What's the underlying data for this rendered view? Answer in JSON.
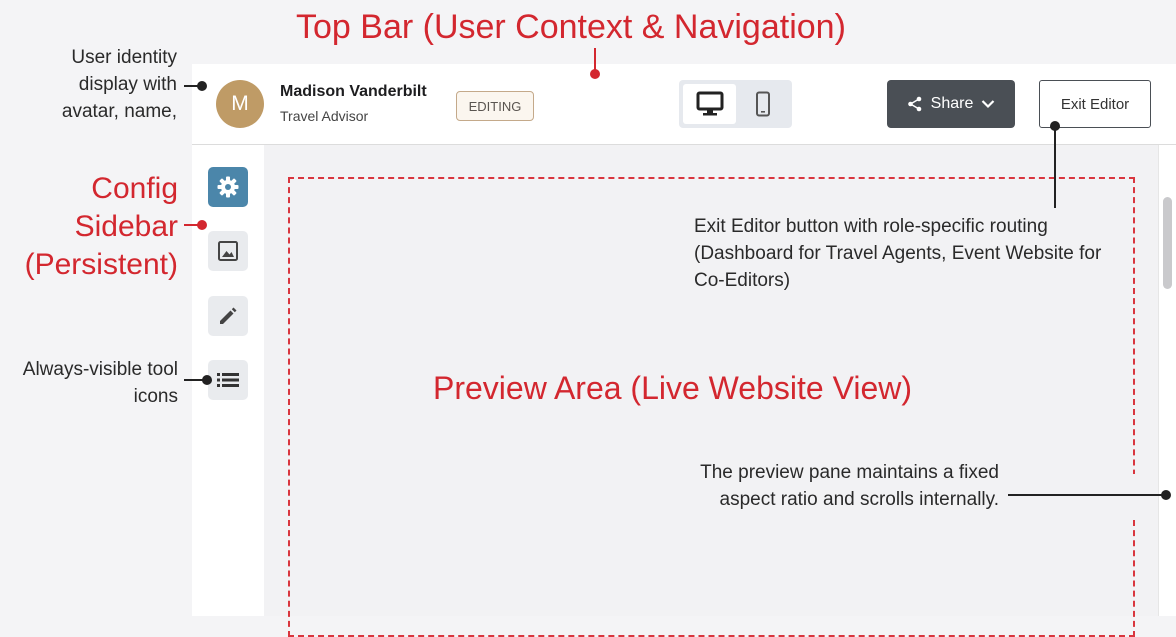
{
  "annotations": {
    "top_bar_title": "Top Bar (User Context & Navigation)",
    "config_sidebar_title": [
      "Config",
      "Sidebar",
      "(Persistent)"
    ],
    "preview_area_title": "Preview Area (Live Website View)",
    "user_identity_note": "User identity display with avatar, name,",
    "tools_note": "Always-visible tool icons",
    "exit_editor_note": "Exit Editor button with role-specific routing (Dashboard for Travel Agents, Event Website for Co-Editors)",
    "preview_note": "The preview pane maintains a fixed aspect ratio and scrolls internally."
  },
  "user": {
    "avatar_initial": "M",
    "name": "Madison Vanderbilt",
    "role": "Travel Advisor",
    "avatar_color": "#bf9b66"
  },
  "status_badge": "EDITING",
  "device_toggle": {
    "options": [
      "desktop-icon",
      "mobile-icon"
    ],
    "selected": "desktop"
  },
  "toolbar": {
    "share_label": "Share",
    "exit_label": "Exit Editor"
  },
  "sidebar": {
    "tools": [
      {
        "icon": "gear-icon",
        "active": true
      },
      {
        "icon": "image-icon",
        "active": false
      },
      {
        "icon": "pencil-icon",
        "active": false
      },
      {
        "icon": "list-icon",
        "active": false
      }
    ]
  },
  "colors": {
    "annotation_red": "#d3272f",
    "active_tool": "#4b86aa",
    "share_button": "#4a4f55"
  }
}
